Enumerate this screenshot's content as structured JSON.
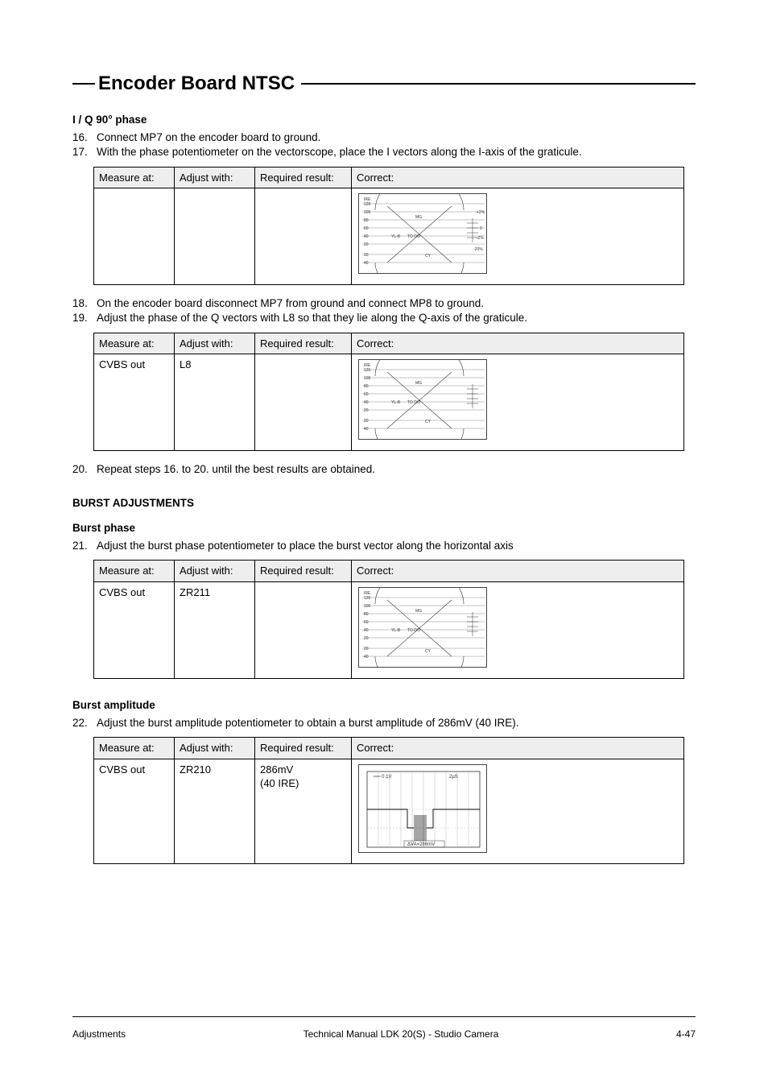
{
  "title": "Encoder Board NTSC",
  "sections": {
    "iq": {
      "heading": "I / Q 90° phase",
      "steps": [
        {
          "n": "16.",
          "t": "Connect MP7 on the encoder board to ground."
        },
        {
          "n": "17.",
          "t": "With the phase potentiometer on the vectorscope, place the I vectors along the I-axis of the graticule."
        }
      ],
      "steps2": [
        {
          "n": "18.",
          "t": "On the encoder board disconnect MP7 from ground and connect MP8 to ground."
        },
        {
          "n": "19.",
          "t": "Adjust the phase of the Q vectors with L8 so that they lie along the Q-axis of the graticule."
        }
      ],
      "steps3": [
        {
          "n": "20.",
          "t": "Repeat steps 16. to 20. until the best results are obtained."
        }
      ]
    },
    "burst": {
      "heading": "BURST ADJUSTMENTS",
      "sub_phase": {
        "heading": "Burst phase",
        "steps": [
          {
            "n": "21.",
            "t": "Adjust the burst phase potentiometer to place the burst vector along the horizontal axis"
          }
        ]
      },
      "sub_amp": {
        "heading": "Burst amplitude",
        "steps": [
          {
            "n": "22.",
            "t": "Adjust the burst amplitude potentiometer to obtain a burst amplitude of 286mV (40 IRE)."
          }
        ]
      }
    }
  },
  "table_headers": {
    "measure": "Measure at:",
    "adjust": "Adjust with:",
    "required": "Required result:",
    "correct": "Correct:"
  },
  "tables": {
    "t1": {
      "measure": "",
      "adjust": "",
      "required": ""
    },
    "t2": {
      "measure": "CVBS out",
      "adjust": "L8",
      "required": ""
    },
    "t3": {
      "measure": "CVBS out",
      "adjust": "ZR211",
      "required": ""
    },
    "t4": {
      "measure": "CVBS out",
      "adjust": "ZR210",
      "required_a": "286mV",
      "required_b": "(40 IRE)"
    }
  },
  "scope_labels": {
    "ire": "IRE",
    "mg": "MG",
    "cy": "CY",
    "yl_b": "YL-B",
    "to_do": "TO DO",
    "scale": [
      "120",
      "100",
      "80",
      "60",
      "40",
      "20",
      "20",
      "40"
    ],
    "pct": [
      "+2%",
      "0",
      "-2%",
      "-20%"
    ]
  },
  "osc_labels": {
    "top_left": "══ 0.1V",
    "top_right": "2µS",
    "bottom": "ΔVA=286mV"
  },
  "footer": {
    "left": "Adjustments",
    "center": "Technical Manual LDK 20(S) - Studio Camera",
    "right": "4-47"
  }
}
